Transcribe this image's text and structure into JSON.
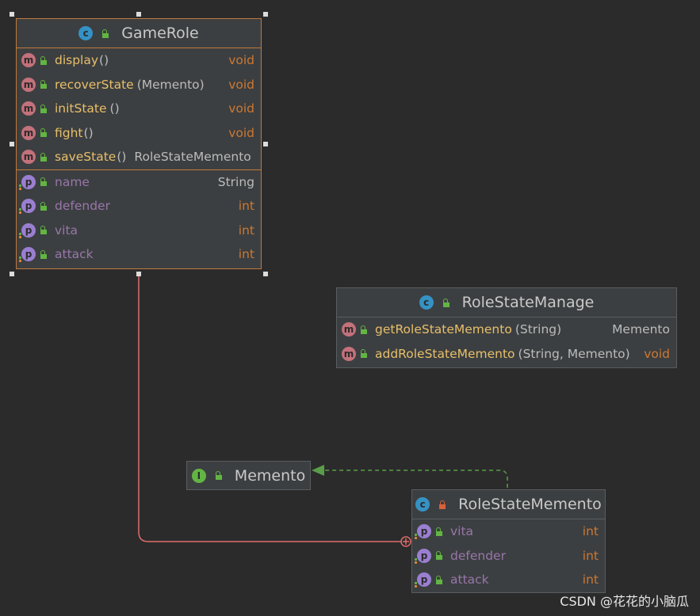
{
  "game_role": {
    "title": "GameRole",
    "methods": [
      {
        "name": "display",
        "params": "()",
        "returns": "void"
      },
      {
        "name": "recoverState",
        "params": "(Memento)",
        "returns": "void"
      },
      {
        "name": "initState",
        "params": "()",
        "returns": "void"
      },
      {
        "name": "fight",
        "params": "()",
        "returns": "void"
      },
      {
        "name": "saveState",
        "params": "()",
        "returns": "RoleStateMemento"
      }
    ],
    "fields": [
      {
        "name": "name",
        "type": "String"
      },
      {
        "name": "defender",
        "type": "int"
      },
      {
        "name": "vita",
        "type": "int"
      },
      {
        "name": "attack",
        "type": "int"
      }
    ]
  },
  "role_state_manage": {
    "title": "RoleStateManage",
    "methods": [
      {
        "name": "getRoleStateMemento",
        "params": "(String)",
        "returns": "Memento"
      },
      {
        "name": "addRoleStateMemento",
        "params": "(String, Memento)",
        "returns": "void"
      }
    ]
  },
  "memento": {
    "title": "Memento"
  },
  "role_state_memento": {
    "title": "RoleStateMemento",
    "fields": [
      {
        "name": "vita",
        "type": "int"
      },
      {
        "name": "defender",
        "type": "int"
      },
      {
        "name": "attack",
        "type": "int"
      }
    ]
  },
  "badges": {
    "class": "c",
    "interface": "I",
    "method": "m",
    "property": "p"
  },
  "colors": {
    "background": "#2b2b2b",
    "node": "#3c3f41",
    "selection": "#c07a3c",
    "method_name": "#e8bf6a",
    "field_name": "#9876aa",
    "return_type": "#cc7832",
    "inner_class_link": "#e06c6c",
    "realization_link": "#5a9e4a"
  },
  "watermark": "CSDN @花花的小脑瓜"
}
